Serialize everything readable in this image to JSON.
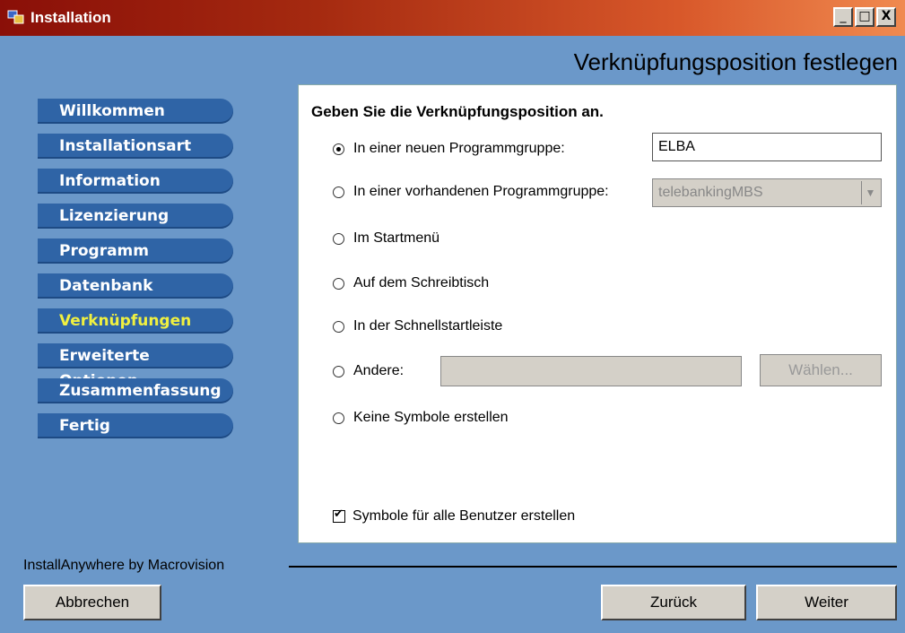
{
  "window": {
    "title": "Installation",
    "minimize": "_",
    "maximize": "□",
    "close": "X"
  },
  "header": {
    "title": "Verknüpfungsposition festlegen"
  },
  "nav": {
    "items": [
      {
        "label": "Willkommen"
      },
      {
        "label": "Installationsart"
      },
      {
        "label": "Information"
      },
      {
        "label": "Lizenzierung"
      },
      {
        "label": "Programm"
      },
      {
        "label": "Datenbank"
      },
      {
        "label": "Verknüpfungen",
        "active": true
      },
      {
        "label": "Erweiterte Optionen"
      },
      {
        "label": "Zusammenfassung"
      },
      {
        "label": "Fertig"
      }
    ],
    "active_color": "#f0f040"
  },
  "content": {
    "prompt": "Geben Sie die Verknüpfungsposition an.",
    "options": {
      "new_group": {
        "label": "In einer neuen Programmgruppe:",
        "selected": true,
        "value": "ELBA"
      },
      "existing_group": {
        "label": "In einer vorhandenen Programmgruppe:",
        "selected": false,
        "value": "telebankingMBS"
      },
      "start_menu": {
        "label": "Im Startmenü",
        "selected": false
      },
      "desktop": {
        "label": "Auf dem Schreibtisch",
        "selected": false
      },
      "quicklaunch": {
        "label": "In der Schnellstartleiste",
        "selected": false
      },
      "other": {
        "label": "Andere:",
        "selected": false,
        "value": "",
        "choose_label": "Wählen..."
      },
      "none": {
        "label": "Keine Symbole erstellen",
        "selected": false
      }
    },
    "all_users": {
      "label": "Symbole für alle Benutzer erstellen",
      "checked": true
    }
  },
  "footer": {
    "brand": "InstallAnywhere by Macrovision",
    "cancel": "Abbrechen",
    "back": "Zurück",
    "next": "Weiter"
  }
}
